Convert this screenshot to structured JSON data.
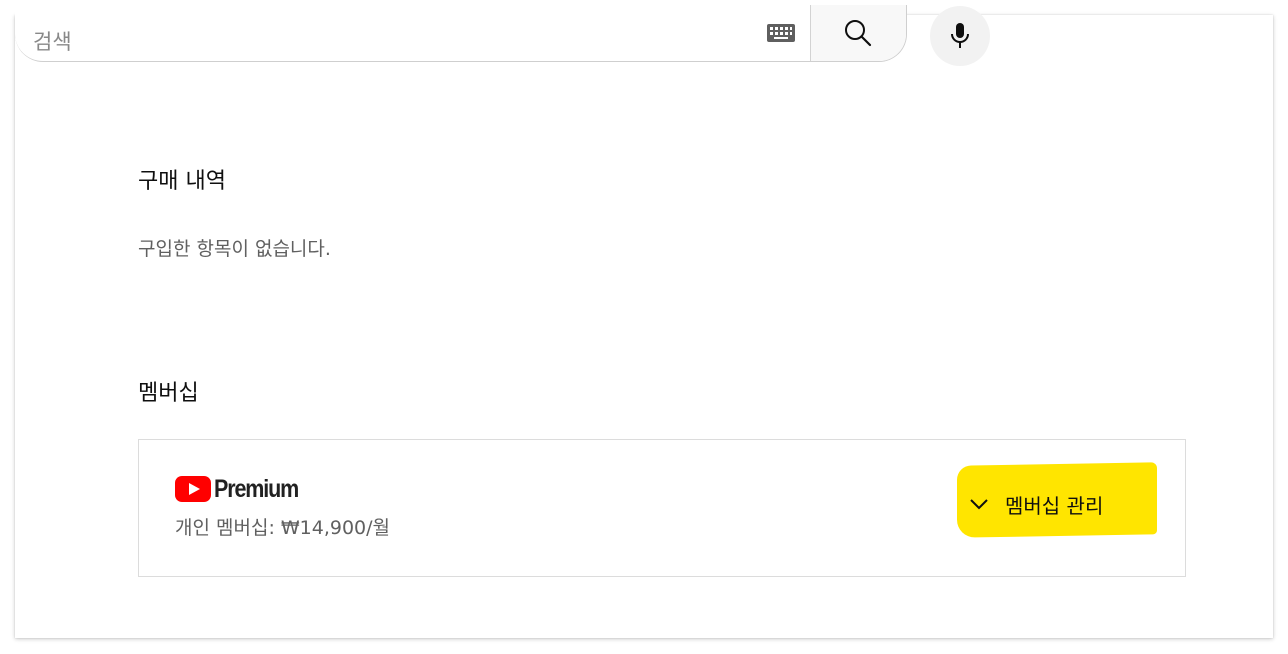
{
  "search": {
    "placeholder": "검색",
    "value": ""
  },
  "icons": {
    "keyboard": "keyboard-icon",
    "search": "search-icon",
    "mic": "mic-icon",
    "chevron": "chevron-down-icon"
  },
  "purchases": {
    "title": "구매 내역",
    "empty_message": "구입한 항목이 없습니다."
  },
  "membership": {
    "title": "멤버십",
    "logo_text": "Premium",
    "plan": "개인 멤버십: ₩14,900/월",
    "manage_label": "멤버십 관리"
  },
  "colors": {
    "brand_red": "#ff0000",
    "highlight": "#ffe500"
  }
}
